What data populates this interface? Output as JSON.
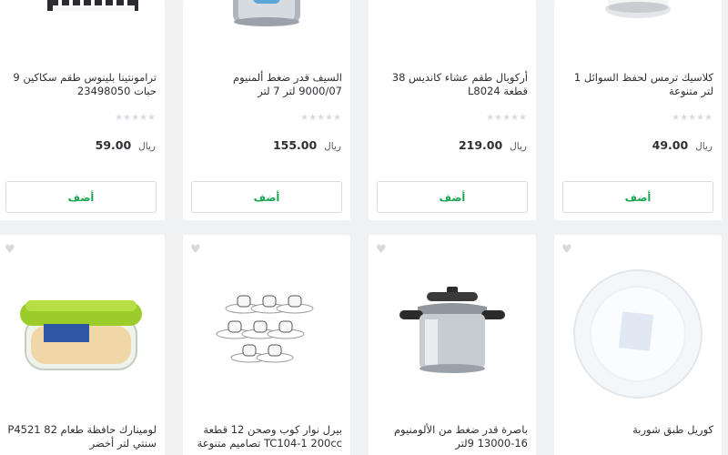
{
  "common": {
    "add_label": "أضف",
    "currency": "ريال",
    "stars": "★★★★★",
    "heart": "♥"
  },
  "products": [
    {
      "title": "كلاسيك ترمس لحفظ السوائل 1 لتر متنوعة",
      "price": "49.00"
    },
    {
      "title": "أركوبال طقم عشاء كانديس 38 قطعة L8024",
      "price": "219.00"
    },
    {
      "title": "السيف قدر ضغط ألمنيوم 9000/07 لتر 7 لتر",
      "price": "155.00"
    },
    {
      "title": "ترامونتينا بلينوس طقم سكاكين 9 حبات 23498050",
      "price": "59.00"
    },
    {
      "title": "كوريل طبق شوربة"
    },
    {
      "title": "باصرة قدر ضغط من الألومنيوم 16-13000 9لتر"
    },
    {
      "title": "بيرل نوار كوب وصحن 12 قطعة TC104-1 200cc تصاميم متنوعة"
    },
    {
      "title": "لومينارك حافظة طعام P4521 82 سنتي لتر أخضر"
    }
  ]
}
